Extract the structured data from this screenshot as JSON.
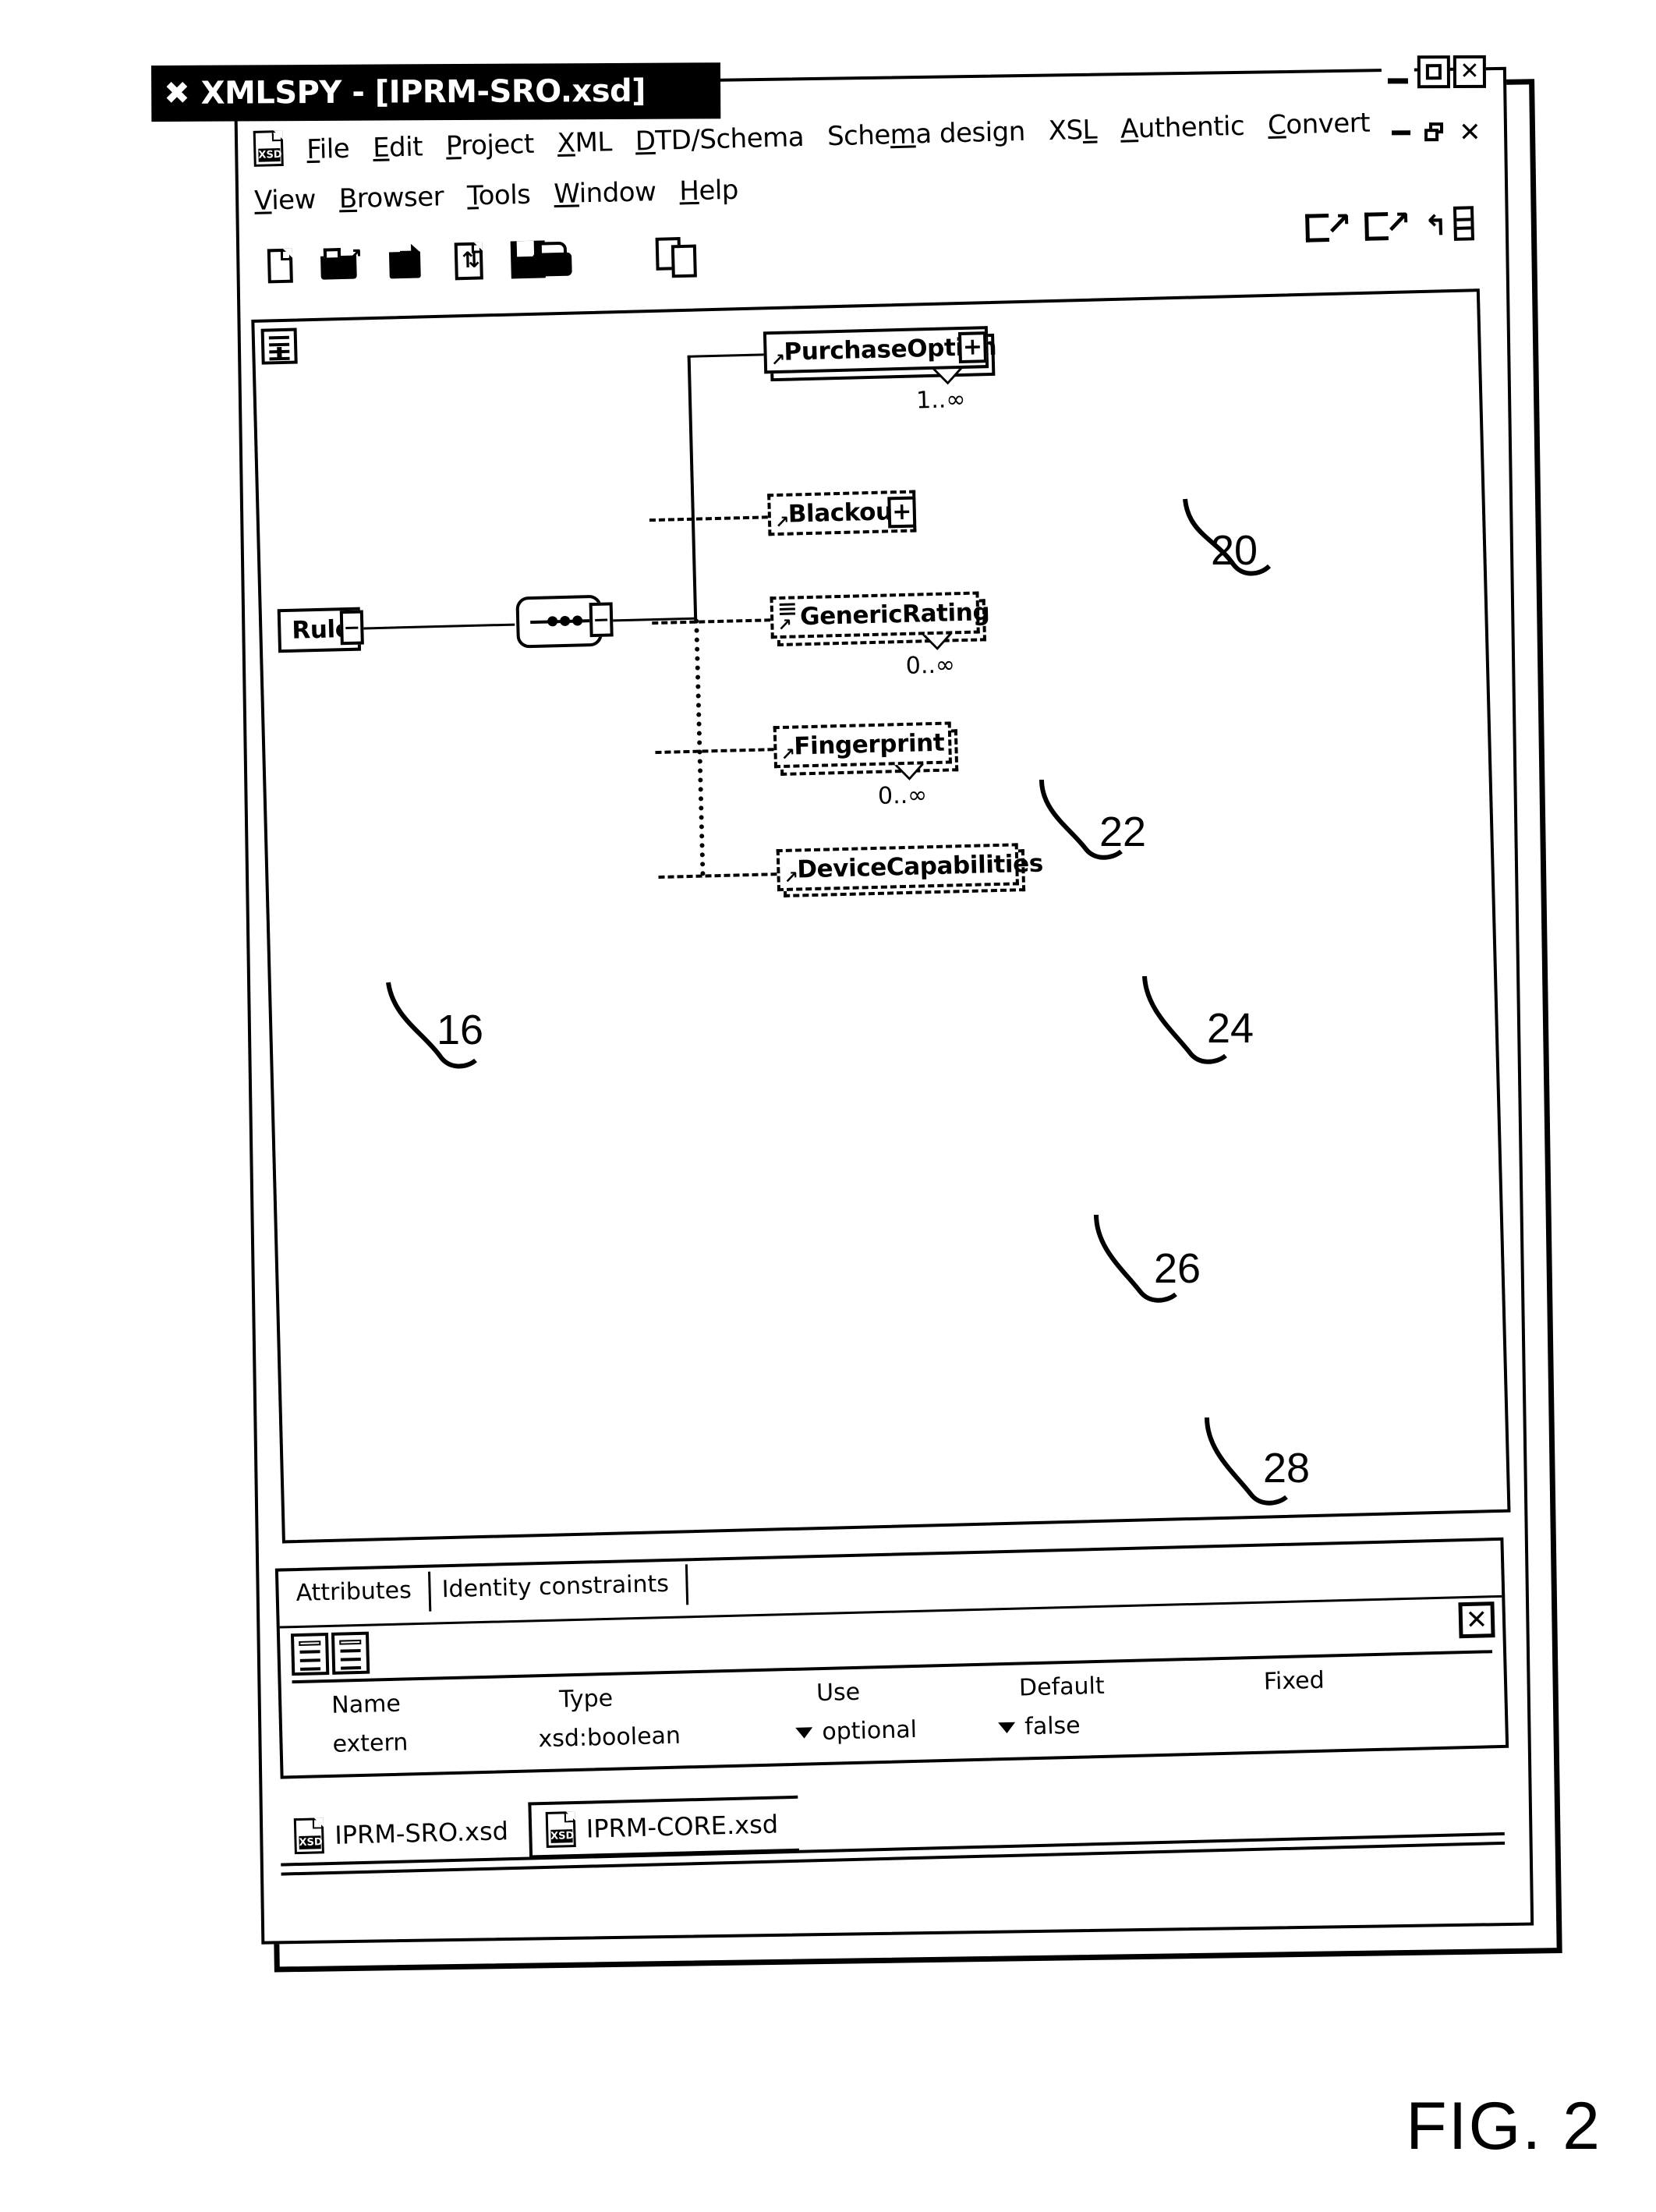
{
  "figure": {
    "label": "FIG. 2"
  },
  "window": {
    "title": "XMLSPY - [IPRM-SRO.xsd]",
    "app_glyph": "app-x-icon",
    "buttons": [
      {
        "name": "minimize",
        "glyph": "_"
      },
      {
        "name": "maximize",
        "glyph": "□"
      },
      {
        "name": "close",
        "glyph": "✕"
      }
    ],
    "mdi_buttons": [
      {
        "name": "mdi-minimize",
        "glyph": "_"
      },
      {
        "name": "mdi-restore",
        "glyph": "❐"
      },
      {
        "name": "mdi-close",
        "glyph": "✕"
      }
    ]
  },
  "menu": {
    "row1": [
      "File",
      "Edit",
      "Project",
      "XML",
      "DTD/Schema",
      "Schema design",
      "XSL",
      "Authentic",
      "Convert"
    ],
    "row2": [
      "View",
      "Browser",
      "Tools",
      "Window",
      "Help"
    ]
  },
  "toolbar": {
    "left": [
      "new-document-icon",
      "open-folder-icon",
      "open-file-icon",
      "reload-icon",
      "save-icon"
    ],
    "print": "print-icon",
    "copy": "copy-icon",
    "right": [
      "append-icon",
      "insert-icon",
      "add-child-icon"
    ]
  },
  "diagram": {
    "corner_icon": "schema-tree-icon",
    "nodes": [
      {
        "id": "rule",
        "label": "Rule",
        "style": "solid",
        "multiple": false,
        "expandable": false,
        "cardinality": "",
        "ref": "16"
      },
      {
        "id": "purchase_option",
        "label": "PurchaseOption",
        "style": "solid",
        "multiple": true,
        "expandable": true,
        "expand_glyph": "+",
        "cardinality": "1..∞",
        "ref": "20"
      },
      {
        "id": "blackout",
        "label": "Blackout",
        "style": "dashed",
        "multiple": false,
        "expandable": true,
        "expand_glyph": "+",
        "cardinality": "",
        "ref": "22"
      },
      {
        "id": "generic_rating",
        "label": "GenericRating",
        "style": "dashed",
        "multiple": true,
        "expandable": false,
        "has_attributes": true,
        "cardinality": "0..∞",
        "ref": "24"
      },
      {
        "id": "fingerprint",
        "label": "Fingerprint",
        "style": "dashed",
        "multiple": true,
        "expandable": false,
        "cardinality": "0..∞",
        "ref": "26"
      },
      {
        "id": "device_capabilities",
        "label": "DeviceCapabilities",
        "style": "dashed",
        "multiple": false,
        "expandable": false,
        "cardinality": "",
        "ref": "28"
      }
    ],
    "compositor": {
      "type": "sequence",
      "name": "sequence-compositor"
    }
  },
  "attributes_panel": {
    "tabs": [
      {
        "label": "Attributes",
        "active": true
      },
      {
        "label": "Identity constraints",
        "active": false
      }
    ],
    "close_glyph": "✕",
    "toolbar_icons": [
      "append-attribute-icon",
      "insert-attribute-icon"
    ],
    "columns": [
      "Name",
      "Type",
      "Use",
      "Default",
      "Fixed"
    ],
    "rows": [
      {
        "name": "extern",
        "type": "xsd:boolean",
        "use": "optional",
        "default": "false",
        "fixed": ""
      }
    ]
  },
  "document_tabs": [
    {
      "label": "IPRM-SRO.xsd",
      "active": true,
      "icon": "xsd-file-icon"
    },
    {
      "label": "IPRM-CORE.xsd",
      "active": false,
      "icon": "xsd-file-icon"
    }
  ]
}
